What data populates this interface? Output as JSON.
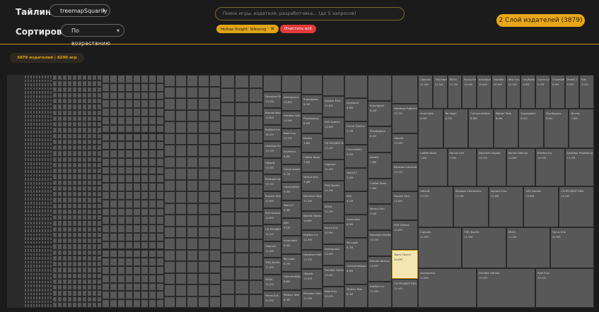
{
  "controls": {
    "tiling_label": "Тайлинг:",
    "tiling_value": "treemapSquarify",
    "sort_label": "Сортировка:",
    "sort_value": "По возрастанию"
  },
  "search": {
    "placeholder": "Поиск игры, издателя, разработчика... (до 5 запросов)",
    "value": ""
  },
  "chips": {
    "active_query": "Hollow Knight: Silksong",
    "remove_icon": "close-icon",
    "clear_all": "Очистить всё"
  },
  "layer_button": "2 Слой издателей (3879)",
  "stats": {
    "publishers": "3879 издателей",
    "separator": " | ",
    "games": "8290 игр"
  },
  "colors": {
    "accent": "#e7a718",
    "danger": "#e23a3a",
    "cell": "#585858",
    "highlight": "#f3e6b2"
  },
  "treemap": {
    "highlighted": {
      "title": "Team Cherry",
      "value": "10.0M"
    },
    "cells": [
      {
        "t": "Devolver Digital",
        "v": "15.2M"
      },
      {
        "t": "Bandai Namco",
        "v": "14.8M"
      },
      {
        "t": "Krafton Inc",
        "v": "14.3M"
      },
      {
        "t": "Gearbox Publishing",
        "v": "13.7M"
      },
      {
        "t": "Ubisoft",
        "v": "13.5M"
      },
      {
        "t": "Paradox Interactive",
        "v": "13.1M"
      },
      {
        "t": "Square Enix",
        "v": "12.8M"
      },
      {
        "t": "505 Games",
        "v": "12.6M"
      },
      {
        "t": "CD PROJEKT RED",
        "v": "12.4M"
      },
      {
        "t": "Capcom",
        "v": "11.9M"
      },
      {
        "t": "THQ Nordic",
        "v": "11.5M"
      },
      {
        "t": "SEGA",
        "v": "11.2M"
      },
      {
        "t": "Focus Ent.",
        "v": "10.9M"
      },
      {
        "t": "Annapurna",
        "v": "10.6M"
      },
      {
        "t": "Humble Games",
        "v": "10.4M"
      },
      {
        "t": "Raw Fury",
        "v": "10.2M"
      },
      {
        "t": "tinyBuild",
        "v": "9.9M"
      },
      {
        "t": "Curve Games",
        "v": "9.7M"
      },
      {
        "t": "Chucklefish",
        "v": "9.5M"
      },
      {
        "t": "Team17",
        "v": "9.3M"
      },
      {
        "t": "Klei",
        "v": "9.1M"
      },
      {
        "t": "Innersloth",
        "v": "8.9M"
      },
      {
        "t": "Re-Logic",
        "v": "8.7M"
      },
      {
        "t": "ConcernedApe",
        "v": "8.6M"
      },
      {
        "t": "Motion Twin",
        "v": "8.4M"
      },
      {
        "t": "Supergiant",
        "v": "8.2M"
      },
      {
        "t": "Playdigious",
        "v": "8.0M"
      },
      {
        "t": "Nicalis",
        "v": "7.8M"
      },
      {
        "t": "Coffee Stain",
        "v": "7.6M"
      },
      {
        "t": "Versus Evil",
        "v": "7.4M"
      }
    ]
  }
}
